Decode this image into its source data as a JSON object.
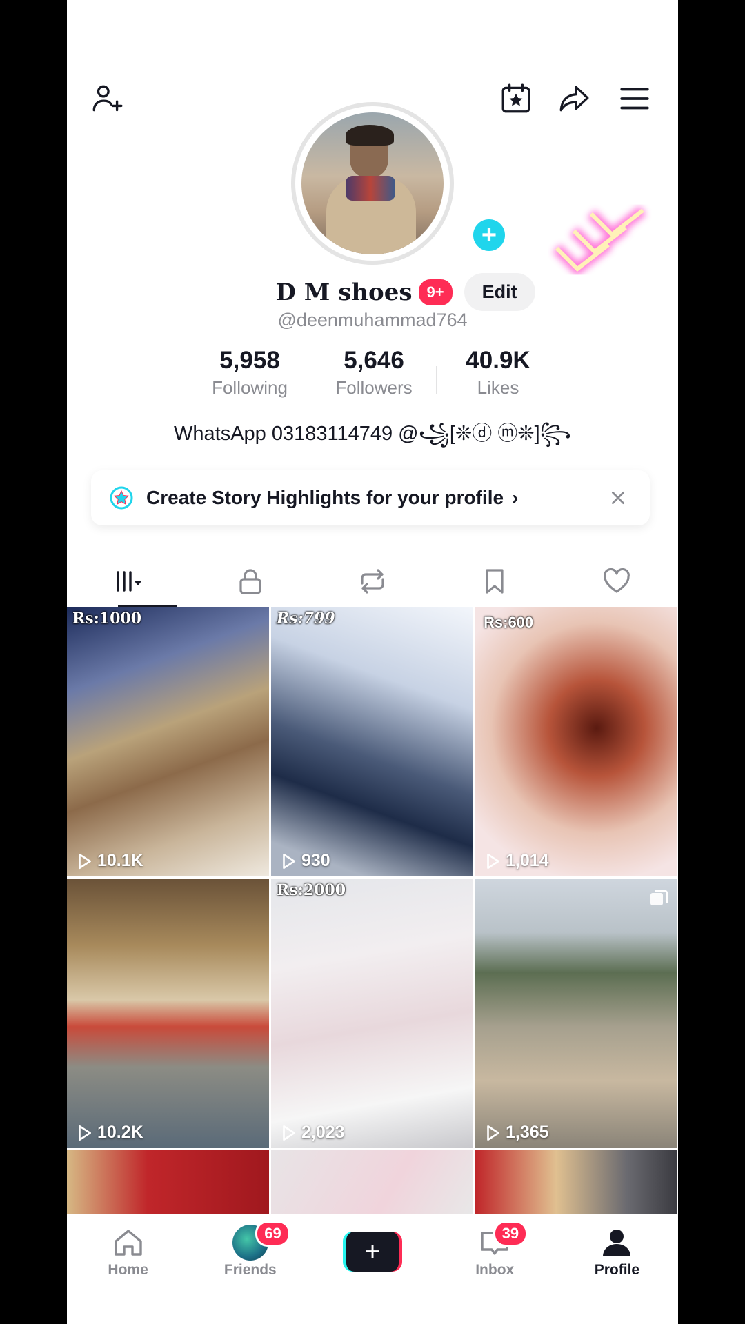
{
  "profile": {
    "display_name": "D M shoes",
    "notification_badge": "9+",
    "edit_label": "Edit",
    "username": "@deenmuhammad764",
    "bio": "WhatsApp 03183114749 @꧁[❊ⓓ ⓜ❊]꧂"
  },
  "stats": [
    {
      "value": "5,958",
      "label": "Following"
    },
    {
      "value": "5,646",
      "label": "Followers"
    },
    {
      "value": "40.9K",
      "label": "Likes"
    }
  ],
  "highlights_banner": {
    "text": "Create Story Highlights for your profile",
    "chevron": "›"
  },
  "tabs": [
    {
      "icon": "grid-icon",
      "active": true
    },
    {
      "icon": "lock-icon"
    },
    {
      "icon": "repost-icon"
    },
    {
      "icon": "bookmark-icon"
    },
    {
      "icon": "heart-icon"
    }
  ],
  "videos": [
    {
      "price": "Rs:1000",
      "views": "10.1K"
    },
    {
      "price": "Rs:799",
      "views": "930"
    },
    {
      "price": "Rs:600",
      "views": "1,014"
    },
    {
      "price": "",
      "views": "10.2K"
    },
    {
      "price": "Rs:2000",
      "views": "2,023"
    },
    {
      "price": "",
      "views": "1,365"
    }
  ],
  "bottom_nav": {
    "home": "Home",
    "friends": "Friends",
    "friends_count": "69",
    "inbox": "Inbox",
    "inbox_count": "39",
    "profile": "Profile"
  },
  "colors": {
    "accent_pink": "#fe2c55",
    "accent_cyan": "#25f4ee",
    "text_primary": "#161823",
    "text_secondary": "#8a8b91"
  }
}
